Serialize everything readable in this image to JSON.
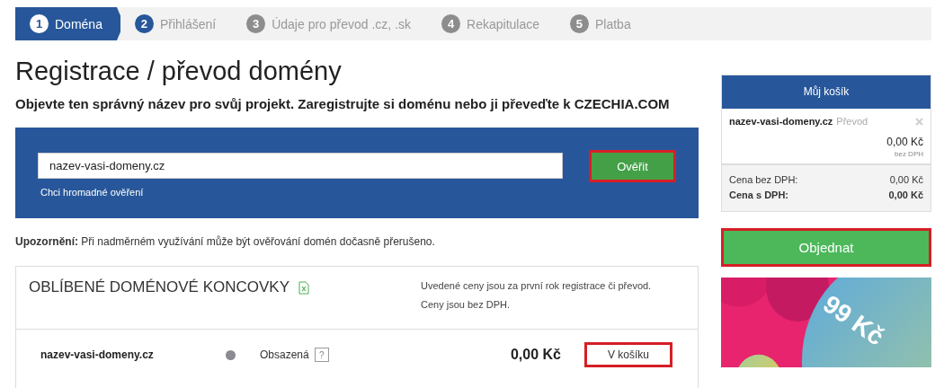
{
  "steps": [
    {
      "number": "1",
      "label": "Doména",
      "selected": true,
      "available": true
    },
    {
      "number": "2",
      "label": "Přihlášení",
      "selected": false,
      "available": true
    },
    {
      "number": "3",
      "label": "Údaje pro převod .cz, .sk",
      "selected": false,
      "available": false
    },
    {
      "number": "4",
      "label": "Rekapitulace",
      "selected": false,
      "available": false
    },
    {
      "number": "5",
      "label": "Platba",
      "selected": false,
      "available": false
    }
  ],
  "title": "Registrace / převod domény",
  "subtitle": "Objevte ten správný název pro svůj projekt. Zaregistrujte si doménu nebo ji převeďte k CZECHIA.COM",
  "search": {
    "value": "nazev-vasi-domeny.cz",
    "button": "Ověřit",
    "button_highlighted": true,
    "bulk_link": "Chci hromadné ověření"
  },
  "warning": "**Upozornění:** Při nadměrném využívání může být ověřování domén dočasně přerušeno.",
  "table": {
    "heading": "OBLÍBENÉ DOMÉNOVÉ KONCOVKY",
    "notes": [
      "Uvedené ceny jsou za první rok registrace či převod.",
      "Ceny jsou bez DPH."
    ],
    "rows": [
      {
        "domain": "nazev-vasi-domeny.cz",
        "color": "#8a8a90",
        "status": "Obsazená",
        "help": "?",
        "price": "0,00 Kč",
        "action": "V košíku",
        "action_highlighted": true
      }
    ]
  },
  "cart": {
    "title": "Můj košík",
    "item": {
      "domain": "nazev-vasi-domeny.cz",
      "type": "Převod",
      "price": "0,00 Kč",
      "price_note": "bez DPH"
    },
    "totals": [
      {
        "label": "Cena bez DPH:",
        "value": "0,00 Kč",
        "bold": false
      },
      {
        "label": "Cena s DPH:",
        "value": "0,00 Kč",
        "bold": true
      }
    ],
    "order_button": "Objednat",
    "order_highlighted": true
  },
  "promo": {
    "kind": "picture",
    "text": "99 Kč"
  }
}
